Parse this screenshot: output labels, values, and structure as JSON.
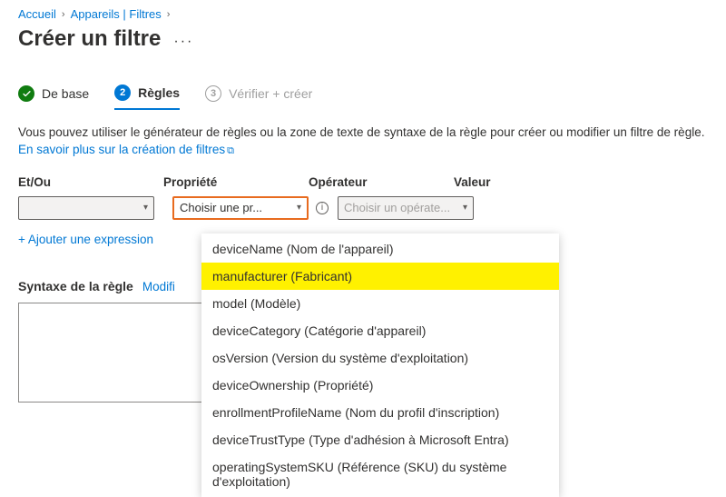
{
  "breadcrumb": {
    "home": "Accueil",
    "devices": "Appareils | Filtres"
  },
  "page_title": "Créer un filtre",
  "tabs": {
    "base": "De base",
    "rules": "Règles",
    "step2_num": "2",
    "step3_num": "3",
    "verify": "Vérifier + créer"
  },
  "intro": {
    "text": "Vous pouvez utiliser le générateur de règles ou la zone de texte de syntaxe de la règle pour créer ou modifier un filtre de règle.",
    "link": "En savoir plus sur la création de filtres"
  },
  "headers": {
    "etou": "Et/Ou",
    "prop": "Propriété",
    "op": "Opérateur",
    "val": "Valeur"
  },
  "row": {
    "prop_placeholder": "Choisir une pr...",
    "op_placeholder": "Choisir un opérate..."
  },
  "add_expr": "+ Ajouter une expression",
  "syntax": {
    "label": "Syntaxe de la règle",
    "edit": "Modifi"
  },
  "dropdown_items": [
    "deviceName (Nom de l'appareil)",
    "manufacturer (Fabricant)",
    "model (Modèle)",
    "deviceCategory (Catégorie d'appareil)",
    "osVersion (Version du système d'exploitation)",
    "deviceOwnership (Propriété)",
    "enrollmentProfileName (Nom du profil d'inscription)",
    "deviceTrustType (Type d'adhésion à Microsoft Entra)",
    "operatingSystemSKU (Référence (SKU) du système d'exploitation)"
  ],
  "highlight_index": 1
}
